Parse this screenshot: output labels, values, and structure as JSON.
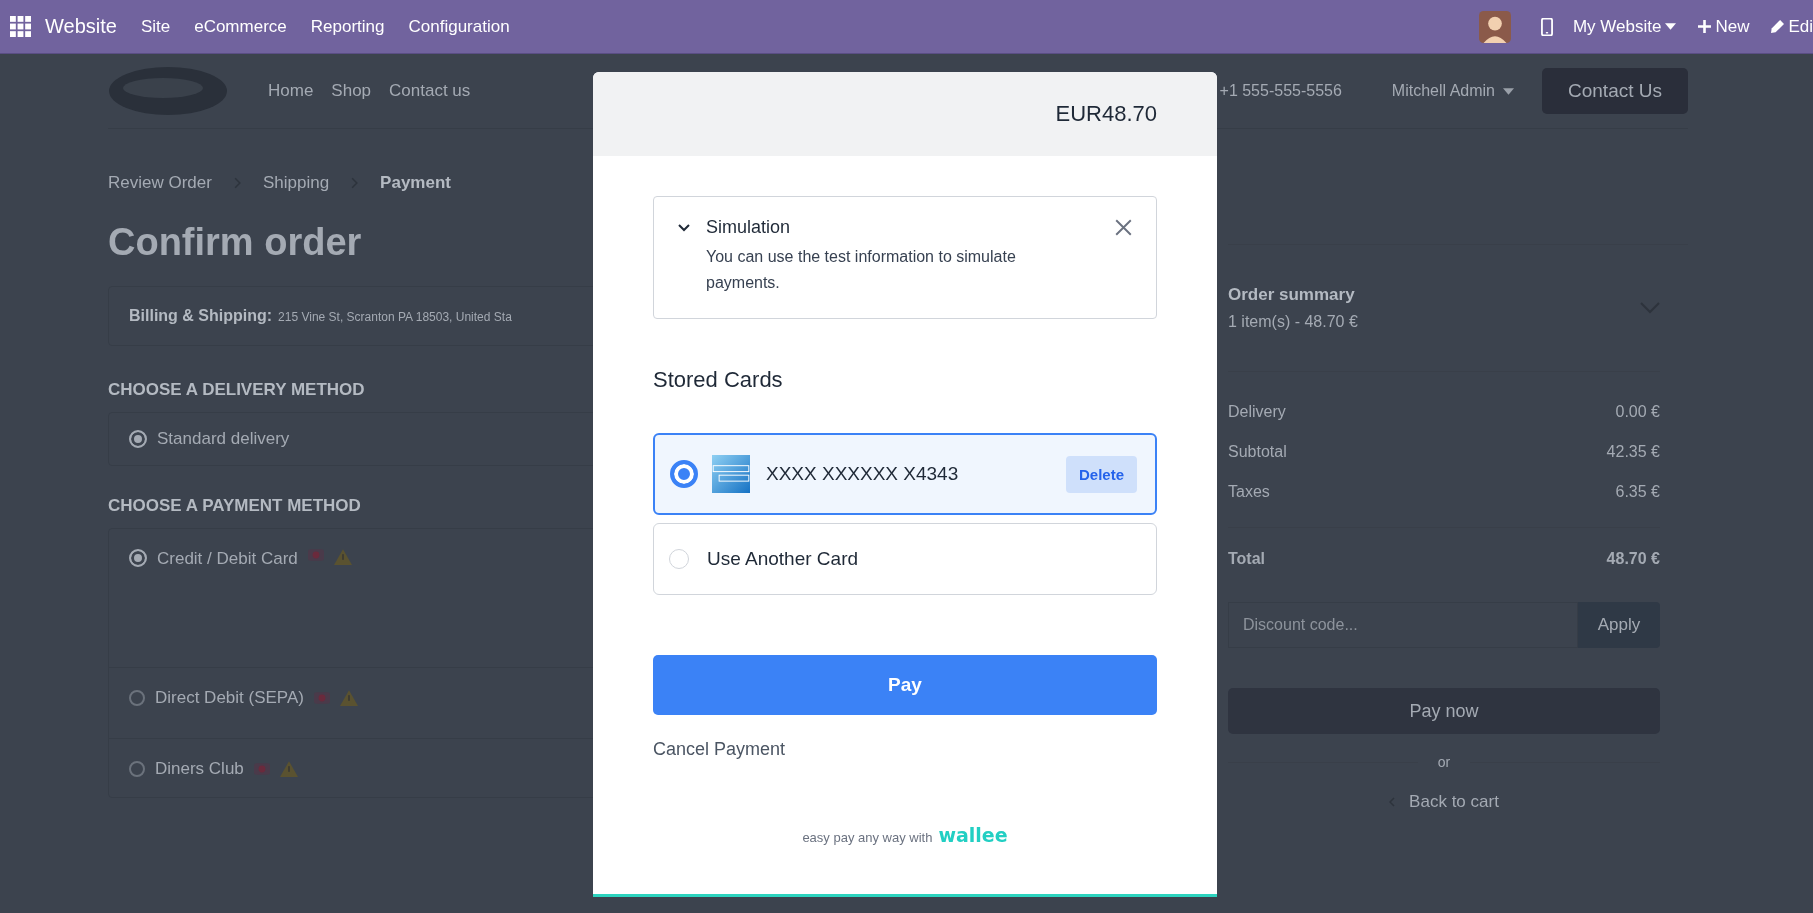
{
  "topbar": {
    "app": "Website",
    "menu": [
      "Site",
      "eCommerce",
      "Reporting",
      "Configuration"
    ],
    "website": "My Website",
    "new": "New",
    "edit": "Edi"
  },
  "site_header": {
    "nav": [
      "Home",
      "Shop",
      "Contact us"
    ],
    "phone": "+1 555-555-5556",
    "user": "Mitchell Admin",
    "contact_button": "Contact Us"
  },
  "breadcrumb": [
    {
      "label": "Review Order",
      "selected": false
    },
    {
      "label": "Shipping",
      "selected": false
    },
    {
      "label": "Payment",
      "selected": true
    }
  ],
  "heading": "Confirm order",
  "billing": {
    "label": "Billing & Shipping:",
    "address": "215 Vine St, Scranton PA 18503, United Sta"
  },
  "delivery": {
    "title": "CHOOSE A DELIVERY METHOD",
    "options": [
      {
        "label": "Standard delivery",
        "selected": true
      }
    ]
  },
  "payment": {
    "title": "CHOOSE A PAYMENT METHOD",
    "methods": [
      {
        "label": "Credit / Debit Card",
        "selected": true
      },
      {
        "label": "Direct Debit (SEPA)",
        "selected": false
      },
      {
        "label": "Diners Club",
        "selected": false
      }
    ]
  },
  "summary": {
    "title": "Order summary",
    "items": "1 item(s) -  48.70 €",
    "lines": [
      {
        "label": "Delivery",
        "value": "0.00 €"
      },
      {
        "label": "Subtotal",
        "value": "42.35 €"
      },
      {
        "label": "Taxes",
        "value": "6.35 €"
      }
    ],
    "total_label": "Total",
    "total": "48.70 €",
    "discount_placeholder": "Discount code...",
    "apply": "Apply",
    "pay_now": "Pay now",
    "or": "or",
    "back": "Back to cart"
  },
  "modal": {
    "amount": "EUR48.70",
    "notice_title": "Simulation",
    "notice_text": "You can use the test information to simulate payments.",
    "stored_title": "Stored Cards",
    "cards": [
      {
        "kind": "stored",
        "label": "XXXX XXXXXX X4343",
        "action": "Delete",
        "selected": true
      },
      {
        "kind": "new",
        "label": "Use Another Card",
        "selected": false
      }
    ],
    "pay": "Pay",
    "cancel": "Cancel Payment",
    "footer": "easy pay any way with",
    "brand": "wallee"
  }
}
